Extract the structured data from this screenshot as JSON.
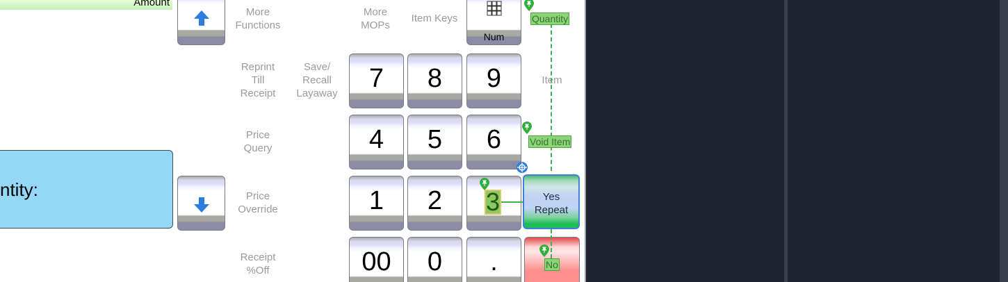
{
  "amount_label": "Amount",
  "quantity_display": "ntity:",
  "labels": {
    "more_functions": [
      "More",
      "Functions"
    ],
    "more_mops": [
      "More",
      "MOPs"
    ],
    "item_keys": "Item Keys",
    "reprint": [
      "Reprint",
      "Till",
      "Receipt"
    ],
    "save_recall": [
      "Save/",
      "Recall",
      "Layaway"
    ],
    "price_query": [
      "Price",
      "Query"
    ],
    "price_override": [
      "Price",
      "Override"
    ],
    "receipt_off": [
      "Receipt",
      "%Off"
    ],
    "item": "Item"
  },
  "num_key_label": "Num",
  "keypad": {
    "row1": [
      "7",
      "8",
      "9"
    ],
    "row2": [
      "4",
      "5",
      "6"
    ],
    "row3": [
      "1",
      "2",
      "3"
    ],
    "row4": [
      "00",
      "0",
      "."
    ]
  },
  "yes_repeat": [
    "Yes",
    "Repeat"
  ],
  "annotations": {
    "quantity": "Quantity",
    "void_item": "Void Item",
    "three": "3",
    "no": "No"
  },
  "colors": {
    "quantity_box": "#95d7f7",
    "annotation_green": "#8fd27a",
    "dark_panel": "#1f2330",
    "selection_blue": "#3f7fe0"
  },
  "icons": [
    "arrow-up-icon",
    "arrow-down-icon",
    "numpad-grid-icon",
    "pin-icon",
    "crosshair-target-icon"
  ]
}
